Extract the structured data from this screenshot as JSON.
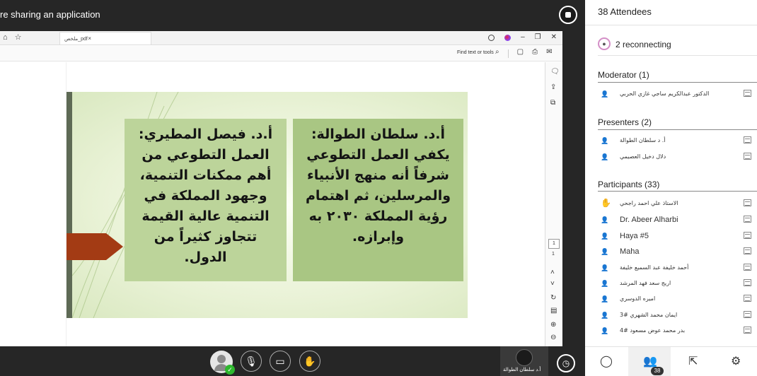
{
  "share_banner": {
    "text": "re sharing an application",
    "stop_icon": "stop-circle-icon"
  },
  "browser": {
    "tab_title": "ملخص_pdf",
    "tab_close": "×",
    "find_text": "Find text or tools",
    "nav_icons": [
      "home-icon",
      "star-icon"
    ],
    "window_icons": [
      "minimize-icon",
      "restore-icon",
      "close-icon"
    ]
  },
  "slide": {
    "quote_right": "أ.د. سلطان الطوالة: يكفي العمل التطوعي شرفاً أنه منهج الأنبياء والمرسلين، ثم اهتمام رؤية المملكة ٢٠٣٠ به وإبرازه.",
    "quote_left": "أ.د. فيصل المطيري: العمل التطوعي من أهم ممكنات التنمية، وجهود المملكة في التنمية عالية القيمة تتجاوز كثيراً من الدول.",
    "accent_color": "#a33b14",
    "box_color": "#a9c683"
  },
  "pdf_side": {
    "page_current": "1",
    "page_total": "1"
  },
  "bottom_bar": {
    "presenter_name": "أ.د سلطان الطوالة",
    "buttons": [
      "mic-off-icon",
      "camera-off-icon",
      "raise-hand-icon"
    ],
    "check": "✓"
  },
  "panel": {
    "title": "38 Attendees",
    "reconnecting": "2 reconnecting",
    "moderator_header": "Moderator (1)",
    "moderators": [
      "الدكتور عبدالكريم ساجي غازي الحربي"
    ],
    "presenters_header": "Presenters (2)",
    "presenters": [
      "أ. د سلطان الطوالة",
      "دلال دخيل العصيمي"
    ],
    "participants_header": "Participants (33)",
    "participants": [
      {
        "name": "الاستاذ علي احمد راجحي",
        "ar": true
      },
      {
        "name": "Dr. Abeer Alharbi",
        "ar": false
      },
      {
        "name": "Haya #5",
        "ar": false
      },
      {
        "name": "Maha",
        "ar": false
      },
      {
        "name": "أحمد خليفة عبد السميع خليفة",
        "ar": true
      },
      {
        "name": "اريج سعد فهد المرشد",
        "ar": true
      },
      {
        "name": "اميره الدوسري",
        "ar": true
      },
      {
        "name": "ايمان محمد الشهري #3",
        "ar": true
      },
      {
        "name": "بدر محمد عوض مسعود #4",
        "ar": true
      }
    ],
    "attendee_count": "38"
  }
}
